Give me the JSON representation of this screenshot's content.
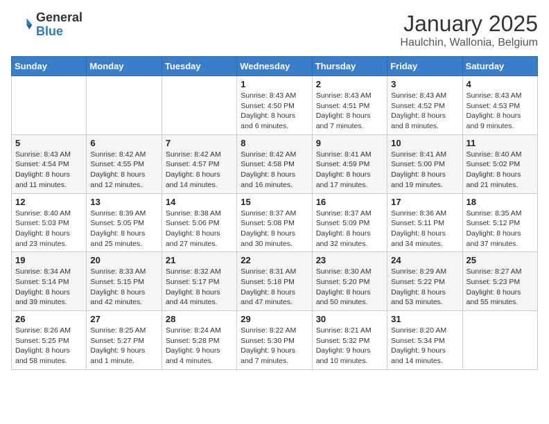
{
  "logo": {
    "general": "General",
    "blue": "Blue"
  },
  "header": {
    "title": "January 2025",
    "location": "Haulchin, Wallonia, Belgium"
  },
  "weekdays": [
    "Sunday",
    "Monday",
    "Tuesday",
    "Wednesday",
    "Thursday",
    "Friday",
    "Saturday"
  ],
  "weeks": [
    [
      {
        "day": "",
        "info": ""
      },
      {
        "day": "",
        "info": ""
      },
      {
        "day": "",
        "info": ""
      },
      {
        "day": "1",
        "info": "Sunrise: 8:43 AM\nSunset: 4:50 PM\nDaylight: 8 hours\nand 6 minutes."
      },
      {
        "day": "2",
        "info": "Sunrise: 8:43 AM\nSunset: 4:51 PM\nDaylight: 8 hours\nand 7 minutes."
      },
      {
        "day": "3",
        "info": "Sunrise: 8:43 AM\nSunset: 4:52 PM\nDaylight: 8 hours\nand 8 minutes."
      },
      {
        "day": "4",
        "info": "Sunrise: 8:43 AM\nSunset: 4:53 PM\nDaylight: 8 hours\nand 9 minutes."
      }
    ],
    [
      {
        "day": "5",
        "info": "Sunrise: 8:43 AM\nSunset: 4:54 PM\nDaylight: 8 hours\nand 11 minutes."
      },
      {
        "day": "6",
        "info": "Sunrise: 8:42 AM\nSunset: 4:55 PM\nDaylight: 8 hours\nand 12 minutes."
      },
      {
        "day": "7",
        "info": "Sunrise: 8:42 AM\nSunset: 4:57 PM\nDaylight: 8 hours\nand 14 minutes."
      },
      {
        "day": "8",
        "info": "Sunrise: 8:42 AM\nSunset: 4:58 PM\nDaylight: 8 hours\nand 16 minutes."
      },
      {
        "day": "9",
        "info": "Sunrise: 8:41 AM\nSunset: 4:59 PM\nDaylight: 8 hours\nand 17 minutes."
      },
      {
        "day": "10",
        "info": "Sunrise: 8:41 AM\nSunset: 5:00 PM\nDaylight: 8 hours\nand 19 minutes."
      },
      {
        "day": "11",
        "info": "Sunrise: 8:40 AM\nSunset: 5:02 PM\nDaylight: 8 hours\nand 21 minutes."
      }
    ],
    [
      {
        "day": "12",
        "info": "Sunrise: 8:40 AM\nSunset: 5:03 PM\nDaylight: 8 hours\nand 23 minutes."
      },
      {
        "day": "13",
        "info": "Sunrise: 8:39 AM\nSunset: 5:05 PM\nDaylight: 8 hours\nand 25 minutes."
      },
      {
        "day": "14",
        "info": "Sunrise: 8:38 AM\nSunset: 5:06 PM\nDaylight: 8 hours\nand 27 minutes."
      },
      {
        "day": "15",
        "info": "Sunrise: 8:37 AM\nSunset: 5:08 PM\nDaylight: 8 hours\nand 30 minutes."
      },
      {
        "day": "16",
        "info": "Sunrise: 8:37 AM\nSunset: 5:09 PM\nDaylight: 8 hours\nand 32 minutes."
      },
      {
        "day": "17",
        "info": "Sunrise: 8:36 AM\nSunset: 5:11 PM\nDaylight: 8 hours\nand 34 minutes."
      },
      {
        "day": "18",
        "info": "Sunrise: 8:35 AM\nSunset: 5:12 PM\nDaylight: 8 hours\nand 37 minutes."
      }
    ],
    [
      {
        "day": "19",
        "info": "Sunrise: 8:34 AM\nSunset: 5:14 PM\nDaylight: 8 hours\nand 39 minutes."
      },
      {
        "day": "20",
        "info": "Sunrise: 8:33 AM\nSunset: 5:15 PM\nDaylight: 8 hours\nand 42 minutes."
      },
      {
        "day": "21",
        "info": "Sunrise: 8:32 AM\nSunset: 5:17 PM\nDaylight: 8 hours\nand 44 minutes."
      },
      {
        "day": "22",
        "info": "Sunrise: 8:31 AM\nSunset: 5:18 PM\nDaylight: 8 hours\nand 47 minutes."
      },
      {
        "day": "23",
        "info": "Sunrise: 8:30 AM\nSunset: 5:20 PM\nDaylight: 8 hours\nand 50 minutes."
      },
      {
        "day": "24",
        "info": "Sunrise: 8:29 AM\nSunset: 5:22 PM\nDaylight: 8 hours\nand 53 minutes."
      },
      {
        "day": "25",
        "info": "Sunrise: 8:27 AM\nSunset: 5:23 PM\nDaylight: 8 hours\nand 55 minutes."
      }
    ],
    [
      {
        "day": "26",
        "info": "Sunrise: 8:26 AM\nSunset: 5:25 PM\nDaylight: 8 hours\nand 58 minutes."
      },
      {
        "day": "27",
        "info": "Sunrise: 8:25 AM\nSunset: 5:27 PM\nDaylight: 9 hours\nand 1 minute."
      },
      {
        "day": "28",
        "info": "Sunrise: 8:24 AM\nSunset: 5:28 PM\nDaylight: 9 hours\nand 4 minutes."
      },
      {
        "day": "29",
        "info": "Sunrise: 8:22 AM\nSunset: 5:30 PM\nDaylight: 9 hours\nand 7 minutes."
      },
      {
        "day": "30",
        "info": "Sunrise: 8:21 AM\nSunset: 5:32 PM\nDaylight: 9 hours\nand 10 minutes."
      },
      {
        "day": "31",
        "info": "Sunrise: 8:20 AM\nSunset: 5:34 PM\nDaylight: 9 hours\nand 14 minutes."
      },
      {
        "day": "",
        "info": ""
      }
    ]
  ]
}
